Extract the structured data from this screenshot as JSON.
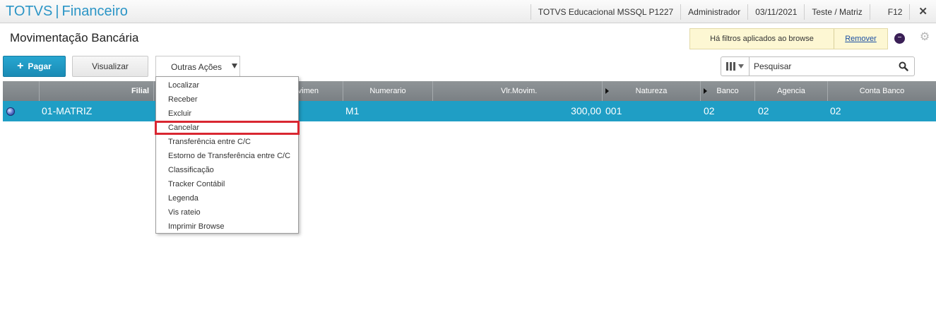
{
  "topbar": {
    "brand": "TOTVS",
    "module": "Financeiro",
    "environment": "TOTVS Educacional MSSQL P1227",
    "user": "Administrador",
    "date": "03/11/2021",
    "branch": "Teste / Matriz",
    "shortcut": "F12",
    "close_glyph": "✕"
  },
  "header": {
    "title": "Movimentação Bancária",
    "filter_notice": "Há filtros aplicados ao browse",
    "filter_remove": "Remover"
  },
  "toolbar": {
    "primary_label": "Pagar",
    "view_label": "Visualizar",
    "other_actions_label": "Outras Ações",
    "search_placeholder": "Pesquisar"
  },
  "menu": {
    "items": [
      {
        "label": "Localizar"
      },
      {
        "label": "Receber"
      },
      {
        "label": "Excluir"
      },
      {
        "label": "Cancelar"
      },
      {
        "label": "Transferência entre C/C"
      },
      {
        "label": "Estorno de Transferência entre C/C"
      },
      {
        "label": "Classificação"
      },
      {
        "label": "Tracker Contábil"
      },
      {
        "label": "Legenda"
      },
      {
        "label": "Vis rateio"
      },
      {
        "label": "Imprimir Browse"
      }
    ]
  },
  "grid": {
    "columns": [
      "Filial",
      "vimen",
      "Numerario",
      "Vlr.Movim.",
      "Natureza",
      "Banco",
      "Agencia",
      "Conta Banco"
    ],
    "row": {
      "filial": "01-MATRIZ",
      "numerario": "M1",
      "valor": "300,00",
      "natureza": "001",
      "banco": "02",
      "agencia": "02",
      "conta": "02"
    }
  },
  "colors": {
    "accent": "#1f9ec5",
    "brand": "#2b95c6",
    "highlight": "#d92731"
  }
}
